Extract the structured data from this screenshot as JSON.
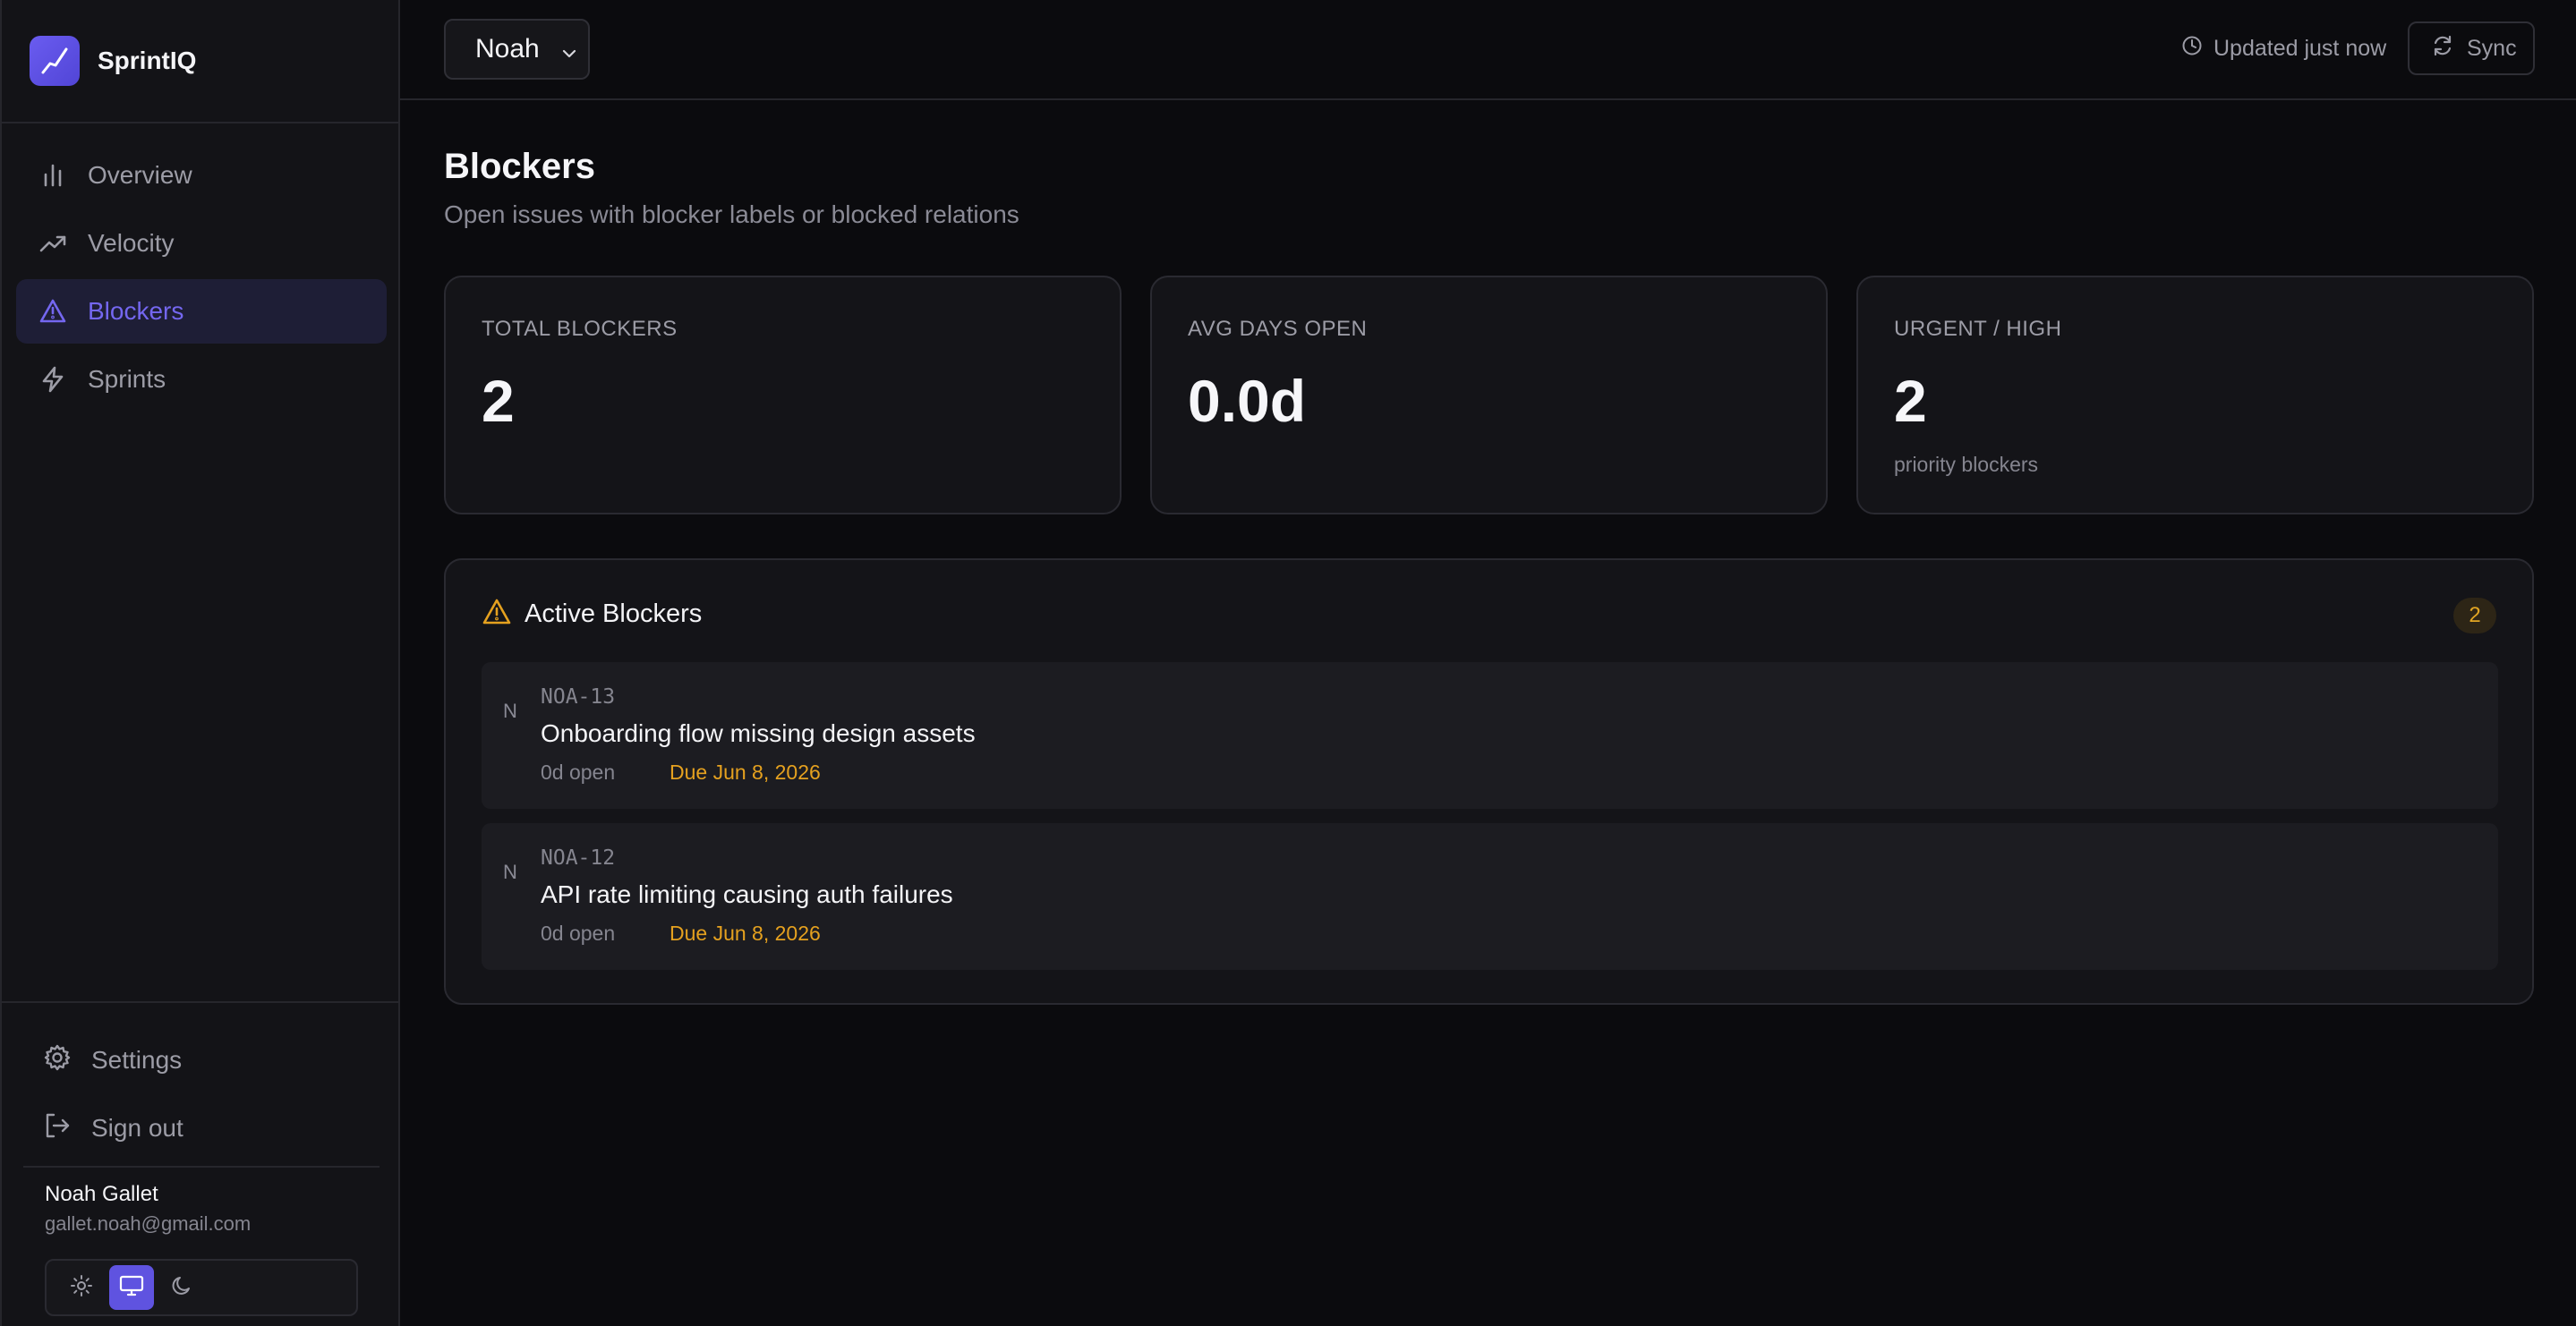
{
  "app": {
    "name": "SprintIQ"
  },
  "sidebar": {
    "items": [
      {
        "label": "Overview",
        "icon": "bar-chart-icon",
        "active": false
      },
      {
        "label": "Velocity",
        "icon": "trending-up-icon",
        "active": false
      },
      {
        "label": "Blockers",
        "icon": "warning-triangle-icon",
        "active": true
      },
      {
        "label": "Sprints",
        "icon": "lightning-icon",
        "active": false
      }
    ],
    "settings_label": "Settings",
    "signout_label": "Sign out",
    "user": {
      "name": "Noah Gallet",
      "email": "gallet.noah@gmail.com"
    },
    "theme": {
      "options": [
        "light",
        "system",
        "dark"
      ],
      "selected": "system"
    }
  },
  "header": {
    "project": "Noah",
    "updated": "Updated just now",
    "sync_label": "Sync"
  },
  "page": {
    "title": "Blockers",
    "subtitle": "Open issues with blocker labels or blocked relations"
  },
  "stats": [
    {
      "label": "TOTAL BLOCKERS",
      "value": "2",
      "sub": ""
    },
    {
      "label": "AVG DAYS OPEN",
      "value": "0.0d",
      "sub": ""
    },
    {
      "label": "URGENT / HIGH",
      "value": "2",
      "sub": "priority blockers"
    }
  ],
  "active_blockers": {
    "title": "Active Blockers",
    "count": "2",
    "issues": [
      {
        "avatar": "N",
        "key": "NOA-13",
        "title": "Onboarding flow missing design assets",
        "open": "0d open",
        "due": "Due Jun 8, 2026"
      },
      {
        "avatar": "N",
        "key": "NOA-12",
        "title": "API rate limiting causing auth failures",
        "open": "0d open",
        "due": "Due Jun 8, 2026"
      }
    ]
  },
  "colors": {
    "accent": "#6a5cf0",
    "warning": "#e5a11f",
    "background": "#0b0b0e",
    "panel": "#141418"
  }
}
